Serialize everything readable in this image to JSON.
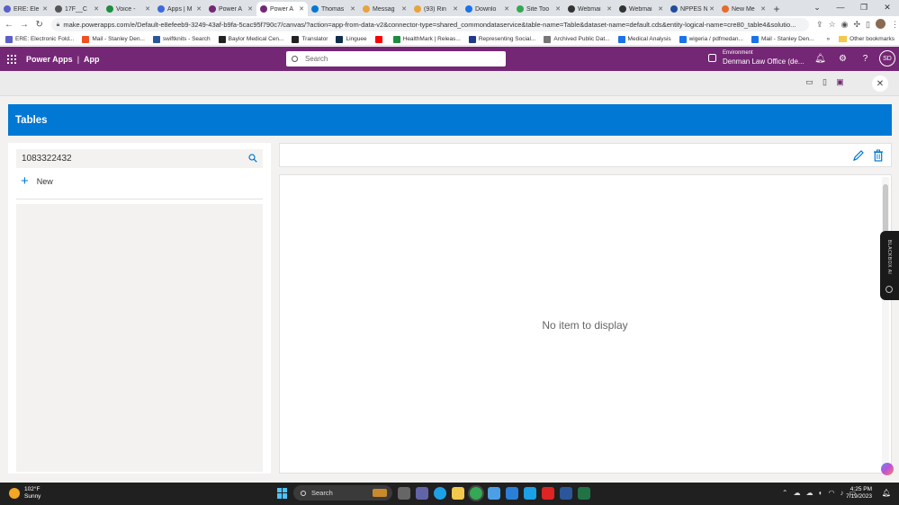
{
  "browser": {
    "tabs": [
      {
        "label": "ERE: Ele",
        "color": "#5b5fc7"
      },
      {
        "label": "17F__C",
        "color": "#555555"
      },
      {
        "label": "Voice - ",
        "color": "#1e8e3e"
      },
      {
        "label": "Apps | M",
        "color": "#3b6bdb"
      },
      {
        "label": "Power A",
        "color": "#742774"
      },
      {
        "label": "Power A",
        "color": "#742774",
        "active": true
      },
      {
        "label": "Thomas",
        "color": "#0078d4"
      },
      {
        "label": "Messag",
        "color": "#e8a33d"
      },
      {
        "label": "(93) Rin",
        "color": "#e8a33d"
      },
      {
        "label": "Downlo",
        "color": "#1a73e8"
      },
      {
        "label": "Site Too",
        "color": "#34a853"
      },
      {
        "label": "Webmai",
        "color": "#333333"
      },
      {
        "label": "Webmai",
        "color": "#333333"
      },
      {
        "label": "NPPES N",
        "color": "#1f4e9c"
      },
      {
        "label": "New Me",
        "color": "#e86b2a"
      }
    ],
    "new_tab": "+",
    "window_controls": [
      "⌄",
      "—",
      "❐",
      "✕"
    ],
    "url": "make.powerapps.com/e/Default-e8efeeb9-3249-43af-b9fa-5cac95f790c7/canvas/?action=app-from-data-v2&connector-type=shared_commondataservice&table-name=Table&dataset-name=default.cds&entity-logical-name=cre80_table4&solutio...",
    "bookmarks": [
      {
        "label": "ERE: Electronic Fold...",
        "color": "#5b5fc7"
      },
      {
        "label": "Mail - Stanley Den...",
        "color": "#f25022"
      },
      {
        "label": "swiftknits - Search",
        "color": "#2b579a"
      },
      {
        "label": "Baylor Medical Cen...",
        "color": "#222222"
      },
      {
        "label": "Translator",
        "color": "#222222"
      },
      {
        "label": "Linguee",
        "color": "#0f2f4e"
      },
      {
        "label": "",
        "color": "#ff0000"
      },
      {
        "label": "HealthMark | Releas...",
        "color": "#1e8e3e"
      },
      {
        "label": "Representing Social...",
        "color": "#1f3a8a"
      },
      {
        "label": "Archived Public Dat...",
        "color": "#777777"
      },
      {
        "label": "Medical Analysis",
        "color": "#1a73e8"
      },
      {
        "label": "wigeria / pdfmedan...",
        "color": "#1a73e8"
      },
      {
        "label": "Mail - Stanley Den...",
        "color": "#1a73e8"
      }
    ],
    "other_bookmarks": "Other bookmarks"
  },
  "header": {
    "product": "Power Apps",
    "separator": "|",
    "app": "App",
    "search_placeholder": "Search",
    "env_label": "Environment",
    "env_name": "Denman Law Office (de...",
    "user_initials": "SD"
  },
  "app": {
    "title": "Tables",
    "search_value": "1083322432",
    "new_label": "New",
    "empty_message": "No item to display"
  },
  "extension": {
    "label": "BLACKBOX AI"
  },
  "taskbar": {
    "temp": "102°F",
    "weather": "Sunny",
    "search_label": "Search",
    "time": "4:25 PM",
    "date": "7/19/2023"
  }
}
